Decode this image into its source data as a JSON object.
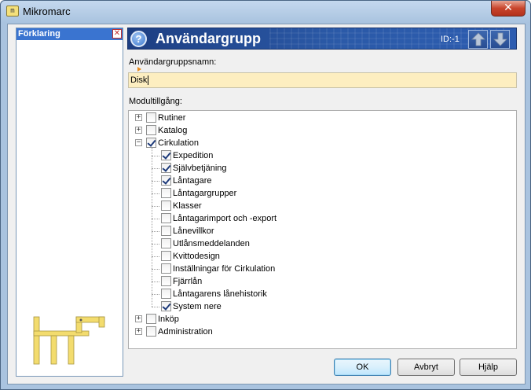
{
  "window": {
    "title": "Mikromarc",
    "close_symbol": "✕"
  },
  "side_panel": {
    "header": "Förklaring",
    "close_symbol": "✕"
  },
  "banner": {
    "title": "Användargrupp",
    "id_text": "ID:-1",
    "help_symbol": "?"
  },
  "form": {
    "name_label": "Användargruppsnamn:",
    "name_value": "Disk",
    "modules_label": "Modultillgång:"
  },
  "tree": [
    {
      "label": "Rutiner",
      "level": 0,
      "checked": false,
      "expander": "+"
    },
    {
      "label": "Katalog",
      "level": 0,
      "checked": false,
      "expander": "+"
    },
    {
      "label": "Cirkulation",
      "level": 0,
      "checked": true,
      "expander": "−"
    },
    {
      "label": "Expedition",
      "level": 1,
      "checked": true
    },
    {
      "label": "Självbetjäning",
      "level": 1,
      "checked": true
    },
    {
      "label": "Låntagare",
      "level": 1,
      "checked": true
    },
    {
      "label": "Låntagargrupper",
      "level": 1,
      "checked": false
    },
    {
      "label": "Klasser",
      "level": 1,
      "checked": false
    },
    {
      "label": "Låntagarimport och -export",
      "level": 1,
      "checked": false
    },
    {
      "label": "Lånevillkor",
      "level": 1,
      "checked": false
    },
    {
      "label": "Utlånsmeddelanden",
      "level": 1,
      "checked": false
    },
    {
      "label": "Kvittodesign",
      "level": 1,
      "checked": false
    },
    {
      "label": "Inställningar för Cirkulation",
      "level": 1,
      "checked": false
    },
    {
      "label": "Fjärrlån",
      "level": 1,
      "checked": false
    },
    {
      "label": "Låntagarens lånehistorik",
      "level": 1,
      "checked": false
    },
    {
      "label": "System nere",
      "level": 1,
      "checked": true
    },
    {
      "label": "Inköp",
      "level": 0,
      "checked": false,
      "expander": "+"
    },
    {
      "label": "Administration",
      "level": 0,
      "checked": false,
      "expander": "+"
    }
  ],
  "buttons": {
    "ok": "OK",
    "cancel": "Avbryt",
    "help": "Hjälp"
  },
  "colors": {
    "banner": "#2b5aa8",
    "input_bg": "#fdeec0",
    "side_header": "#3a74d0"
  }
}
